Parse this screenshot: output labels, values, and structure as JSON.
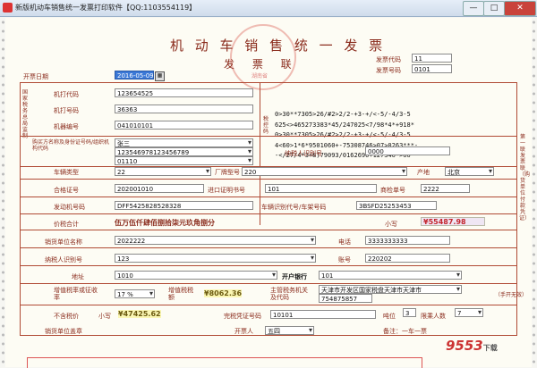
{
  "window": {
    "title": "新版机动车销售统一发票打印软件【QQ:1103554119】",
    "min": "—",
    "max": "□",
    "close": "✕"
  },
  "invoice": {
    "title": "机 动 车 销 售 统 一 发 票",
    "subtitle": "发 票 联",
    "seal_text": "湖南省",
    "invoice_code_label": "发票代码",
    "invoice_code": "11",
    "invoice_no_label": "发票号码",
    "invoice_no": "0101",
    "issue_date_label": "开票日期",
    "issue_date": "2016-05-09"
  },
  "top_left": {
    "machine_code_label": "机打代码",
    "machine_code": "123654525",
    "machine_no_label": "机打号码",
    "machine_no": "36363",
    "machine_serial_label": "机器编号",
    "machine_serial": "041010101"
  },
  "tax_control": {
    "label": "税控码",
    "lines": [
      "0>30**7305>26/#2>2/2-+3-+/<-5/-4/3-5",
      "625<>465273383*45/247025<7/98*4*+918*",
      "0>30**7305>26/#2>2/2-+3-+/<-5/-4/3-5",
      "4<60>1*6*9501060+-75308746>07>0263***-",
      "-</27/4*3+8)79093/0162690+127346->60"
    ]
  },
  "buyer": {
    "side_label": "购买方名称及身份证号码/组织机构代码",
    "name": "张三",
    "id": "123546978123456789",
    "org_code": "01110",
    "taxpayer_label": "纳税人识别号",
    "taxpayer_id": "0000"
  },
  "vehicle": {
    "type_label": "车辆类型",
    "type": "22",
    "brand_label": "厂牌型号",
    "brand": "220",
    "origin_label": "产地",
    "origin": "北京",
    "cert_label": "合格证号",
    "cert": "202001010",
    "import_label": "进口证明书号",
    "import_no": "101",
    "inspect_label": "商检单号",
    "inspect_no": "2222",
    "engine_label": "发动机号码",
    "engine": "DFF5425828528328",
    "vin_label": "车辆识别代号/车架号码",
    "vin": "3BSFD25253453"
  },
  "amount": {
    "total_label": "价税合计",
    "total_words": "伍万伍仟肆佰捌拾柒元玖角捌分",
    "small_label": "小写",
    "total_small": "¥55487.98"
  },
  "seller": {
    "name_label": "销货单位名称",
    "name": "2022222",
    "phone_label": "电话",
    "phone": "3333333333",
    "taxid_label": "纳税人识别号",
    "taxid": "123",
    "account_label": "账号",
    "account": "220202",
    "address_label": "地址",
    "address": "1010",
    "bank_label": "开户银行",
    "bank": "101"
  },
  "tax": {
    "rate_label": "增值税率或征收率",
    "rate": "17 %",
    "vat_label": "增值税税额",
    "vat": "¥8062.36",
    "authority_label": "主管税务机关及代码",
    "authority": "天津市开发区国家税盘天津市天津市",
    "authority_code": "754875857",
    "pretax_label": "不含税价",
    "pretax_small_label": "小写",
    "pretax": "¥47425.62",
    "duty_label": "完税凭证号码",
    "duty": "10101",
    "tonnage_label": "吨位",
    "tonnage": "3",
    "seats_label": "限乘人数",
    "seats": "7"
  },
  "footer": {
    "seller_stamp_label": "销货单位盖章",
    "issuer_label": "开票人",
    "issuer": "五四",
    "note_label": "备注：一车一票"
  },
  "side": {
    "left_vertical": "国家税务总局监制",
    "right_vertical": "第一联 发票联（购货单位付款凭证）",
    "right_hand": "（手开无效）"
  },
  "watermark": {
    "main": "9553",
    "sub": "下载"
  },
  "colors": {
    "ink": "#8a2b1c",
    "line": "#b04a34",
    "highlight": "#c3262e",
    "date_bg": "#3b78d6"
  }
}
